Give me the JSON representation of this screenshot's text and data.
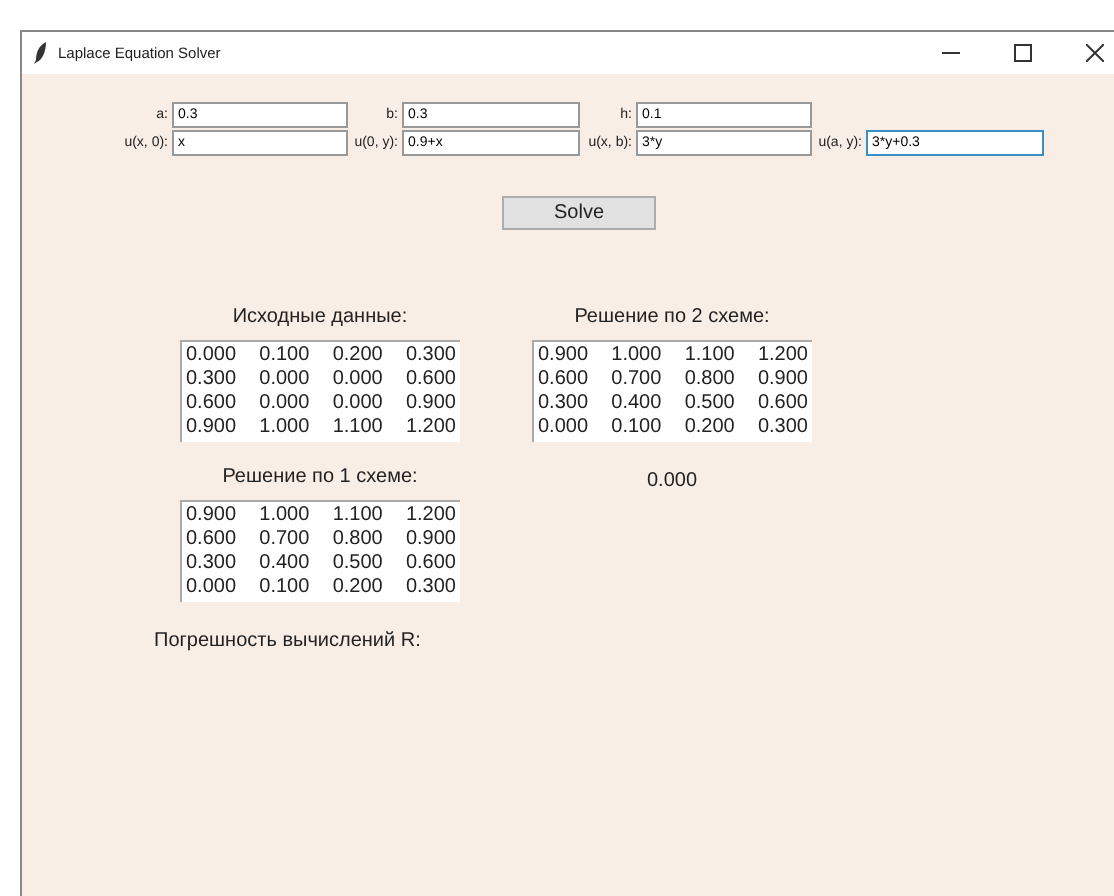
{
  "window": {
    "title": "Laplace Equation Solver"
  },
  "fields": [
    {
      "label": "a:",
      "value": "0.3",
      "focused": false
    },
    {
      "label": "b:",
      "value": "0.3",
      "focused": false
    },
    {
      "label": "h:",
      "value": "0.1",
      "focused": false
    },
    {
      "label": "u(x, 0):",
      "value": "x",
      "focused": false
    },
    {
      "label": "u(0, y):",
      "value": "0.9+x",
      "focused": false
    },
    {
      "label": "u(x, b):",
      "value": "3*y",
      "focused": false
    },
    {
      "label": "u(a, y):",
      "value": "3*y+0.3",
      "focused": true
    }
  ],
  "solve_button": "Solve",
  "initial": {
    "title": "Исходные данные:",
    "rows": [
      [
        "0.000",
        "0.100",
        "0.200",
        "0.300"
      ],
      [
        "0.300",
        "0.000",
        "0.000",
        "0.600"
      ],
      [
        "0.600",
        "0.000",
        "0.000",
        "0.900"
      ],
      [
        "0.900",
        "1.000",
        "1.100",
        "1.200"
      ]
    ]
  },
  "scheme_1": {
    "title": "Решение по 1 схеме:",
    "rows": [
      [
        "0.900",
        "1.000",
        "1.100",
        "1.200"
      ],
      [
        "0.600",
        "0.700",
        "0.800",
        "0.900"
      ],
      [
        "0.300",
        "0.400",
        "0.500",
        "0.600"
      ],
      [
        "0.000",
        "0.100",
        "0.200",
        "0.300"
      ]
    ]
  },
  "scheme_2": {
    "title": "Решение по 2 схеме:",
    "rows": [
      [
        "0.900",
        "1.000",
        "1.100",
        "1.200"
      ],
      [
        "0.600",
        "0.700",
        "0.800",
        "0.900"
      ],
      [
        "0.300",
        "0.400",
        "0.500",
        "0.600"
      ],
      [
        "0.000",
        "0.100",
        "0.200",
        "0.300"
      ]
    ]
  },
  "error": {
    "label": "Погрешность вычислений R:",
    "value": "0.000"
  }
}
